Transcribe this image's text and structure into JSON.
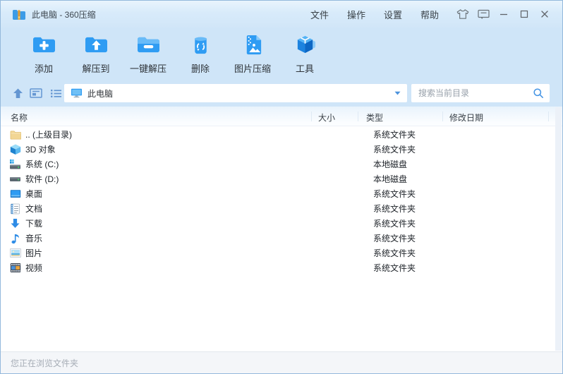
{
  "window": {
    "title": "此电脑 - 360压缩",
    "app_icon": "zip-folder-icon"
  },
  "menubar": {
    "items": [
      {
        "key": "file",
        "label": "文件"
      },
      {
        "key": "action",
        "label": "操作"
      },
      {
        "key": "settings",
        "label": "设置"
      },
      {
        "key": "help",
        "label": "帮助"
      }
    ]
  },
  "titlebar_controls": [
    {
      "icon": "skin-icon"
    },
    {
      "icon": "feedback-icon"
    },
    {
      "icon": "minimize-icon"
    },
    {
      "icon": "maximize-icon"
    },
    {
      "icon": "close-icon"
    }
  ],
  "toolbar": {
    "buttons": [
      {
        "key": "add",
        "label": "添加",
        "icon": "add-archive-icon"
      },
      {
        "key": "extract-to",
        "label": "解压到",
        "icon": "extract-to-icon"
      },
      {
        "key": "one-click-extract",
        "label": "一键解压",
        "icon": "one-click-extract-icon"
      },
      {
        "key": "delete",
        "label": "删除",
        "icon": "delete-icon"
      },
      {
        "key": "image-compress",
        "label": "图片压缩",
        "icon": "image-compress-icon"
      },
      {
        "key": "tools",
        "label": "工具",
        "icon": "tools-icon"
      }
    ]
  },
  "addressbar": {
    "nav_icons": [
      {
        "key": "up",
        "icon": "up-icon"
      },
      {
        "key": "panel-view",
        "icon": "panel-view-icon"
      },
      {
        "key": "list-view",
        "icon": "list-view-icon"
      }
    ],
    "location_icon": "computer-icon",
    "location": "此电脑",
    "dropdown_icon": "chevron-down-icon",
    "search_placeholder": "搜索当前目录",
    "search_icon": "search-icon"
  },
  "table": {
    "columns": [
      {
        "key": "name",
        "label": "名称"
      },
      {
        "key": "size",
        "label": "大小"
      },
      {
        "key": "type",
        "label": "类型"
      },
      {
        "key": "date",
        "label": "修改日期"
      }
    ],
    "rows": [
      {
        "icon": "folder-up-icon",
        "name": ".. (上级目录)",
        "size": "",
        "type": "系统文件夹",
        "date": ""
      },
      {
        "icon": "objects-3d-icon",
        "name": "3D 对象",
        "size": "",
        "type": "系统文件夹",
        "date": ""
      },
      {
        "icon": "system-drive-icon",
        "name": "系统 (C:)",
        "size": "",
        "type": "本地磁盘",
        "date": ""
      },
      {
        "icon": "local-drive-icon",
        "name": "软件 (D:)",
        "size": "",
        "type": "本地磁盘",
        "date": ""
      },
      {
        "icon": "desktop-icon",
        "name": "桌面",
        "size": "",
        "type": "系统文件夹",
        "date": ""
      },
      {
        "icon": "documents-icon",
        "name": "文档",
        "size": "",
        "type": "系统文件夹",
        "date": ""
      },
      {
        "icon": "downloads-icon",
        "name": "下载",
        "size": "",
        "type": "系统文件夹",
        "date": ""
      },
      {
        "icon": "music-icon",
        "name": "音乐",
        "size": "",
        "type": "系统文件夹",
        "date": ""
      },
      {
        "icon": "pictures-icon",
        "name": "图片",
        "size": "",
        "type": "系统文件夹",
        "date": ""
      },
      {
        "icon": "videos-icon",
        "name": "视频",
        "size": "",
        "type": "系统文件夹",
        "date": ""
      }
    ]
  },
  "statusbar": {
    "text": "您正在浏览文件夹"
  },
  "colors": {
    "accent": "#2f9cf3",
    "chrome": "#cfe5f8",
    "titlebar": "#d8ebfa",
    "nav_icon": "#6496d2",
    "text": "#2e3338",
    "muted_text": "#a6adb6",
    "status_bg": "#f4f6f9"
  }
}
